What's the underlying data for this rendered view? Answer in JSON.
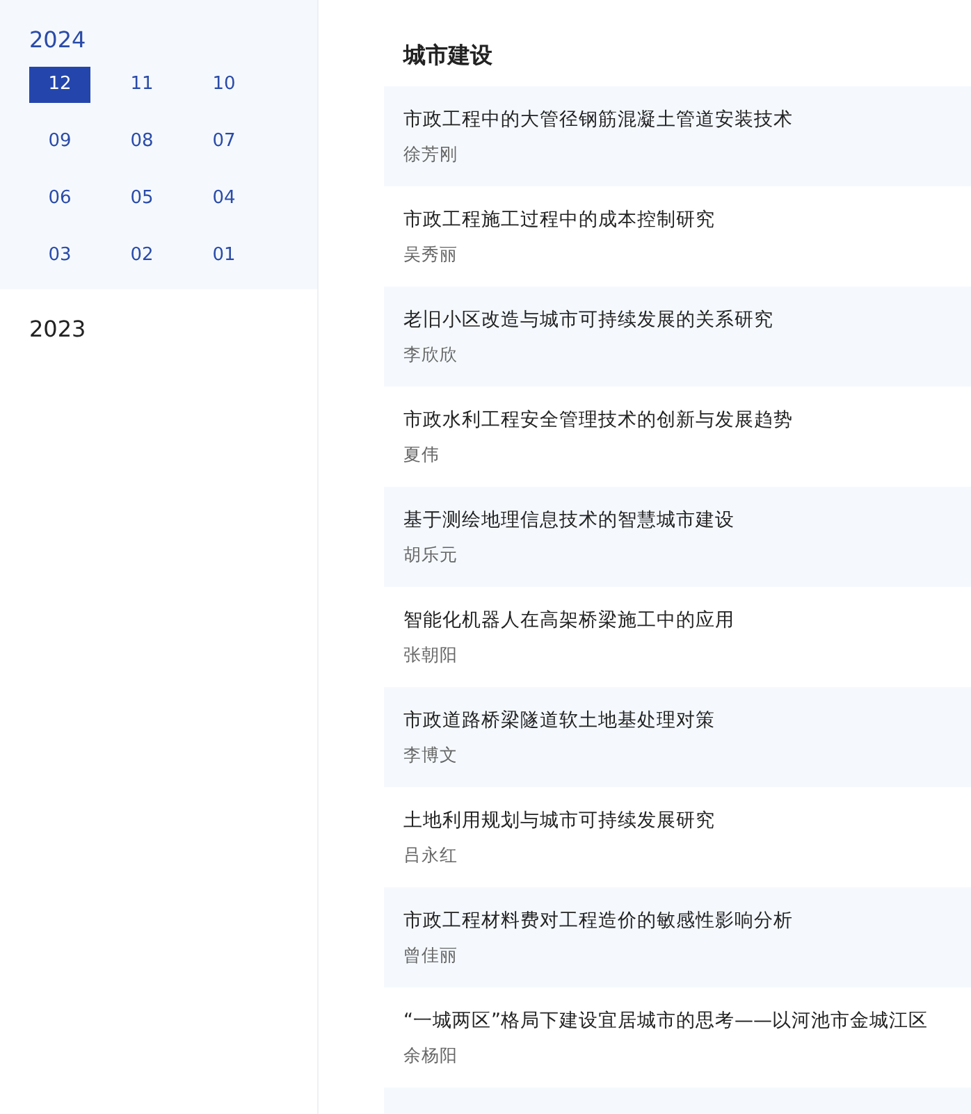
{
  "sidebar": {
    "years": [
      {
        "label": "2024",
        "expanded": true,
        "months": [
          {
            "label": "12",
            "selected": true
          },
          {
            "label": "11",
            "selected": false
          },
          {
            "label": "10",
            "selected": false
          },
          {
            "label": "09",
            "selected": false
          },
          {
            "label": "08",
            "selected": false
          },
          {
            "label": "07",
            "selected": false
          },
          {
            "label": "06",
            "selected": false
          },
          {
            "label": "05",
            "selected": false
          },
          {
            "label": "04",
            "selected": false
          },
          {
            "label": "03",
            "selected": false
          },
          {
            "label": "02",
            "selected": false
          },
          {
            "label": "01",
            "selected": false
          }
        ]
      },
      {
        "label": "2023",
        "expanded": false
      }
    ]
  },
  "section": {
    "title": "城市建设",
    "articles": [
      {
        "title": "市政工程中的大管径钢筋混凝土管道安装技术",
        "author": "徐芳刚"
      },
      {
        "title": "市政工程施工过程中的成本控制研究",
        "author": "吴秀丽"
      },
      {
        "title": "老旧小区改造与城市可持续发展的关系研究",
        "author": "李欣欣"
      },
      {
        "title": "市政水利工程安全管理技术的创新与发展趋势",
        "author": "夏伟"
      },
      {
        "title": "基于测绘地理信息技术的智慧城市建设",
        "author": "胡乐元"
      },
      {
        "title": "智能化机器人在高架桥梁施工中的应用",
        "author": "张朝阳"
      },
      {
        "title": "市政道路桥梁隧道软土地基处理对策",
        "author": "李博文"
      },
      {
        "title": "土地利用规划与城市可持续发展研究",
        "author": "吕永红"
      },
      {
        "title": "市政工程材料费对工程造价的敏感性影响分析",
        "author": "曾佳丽"
      },
      {
        "title": "“一城两区”格局下建设宜居城市的思考——以河池市金城江区",
        "author": "余杨阳"
      }
    ]
  }
}
